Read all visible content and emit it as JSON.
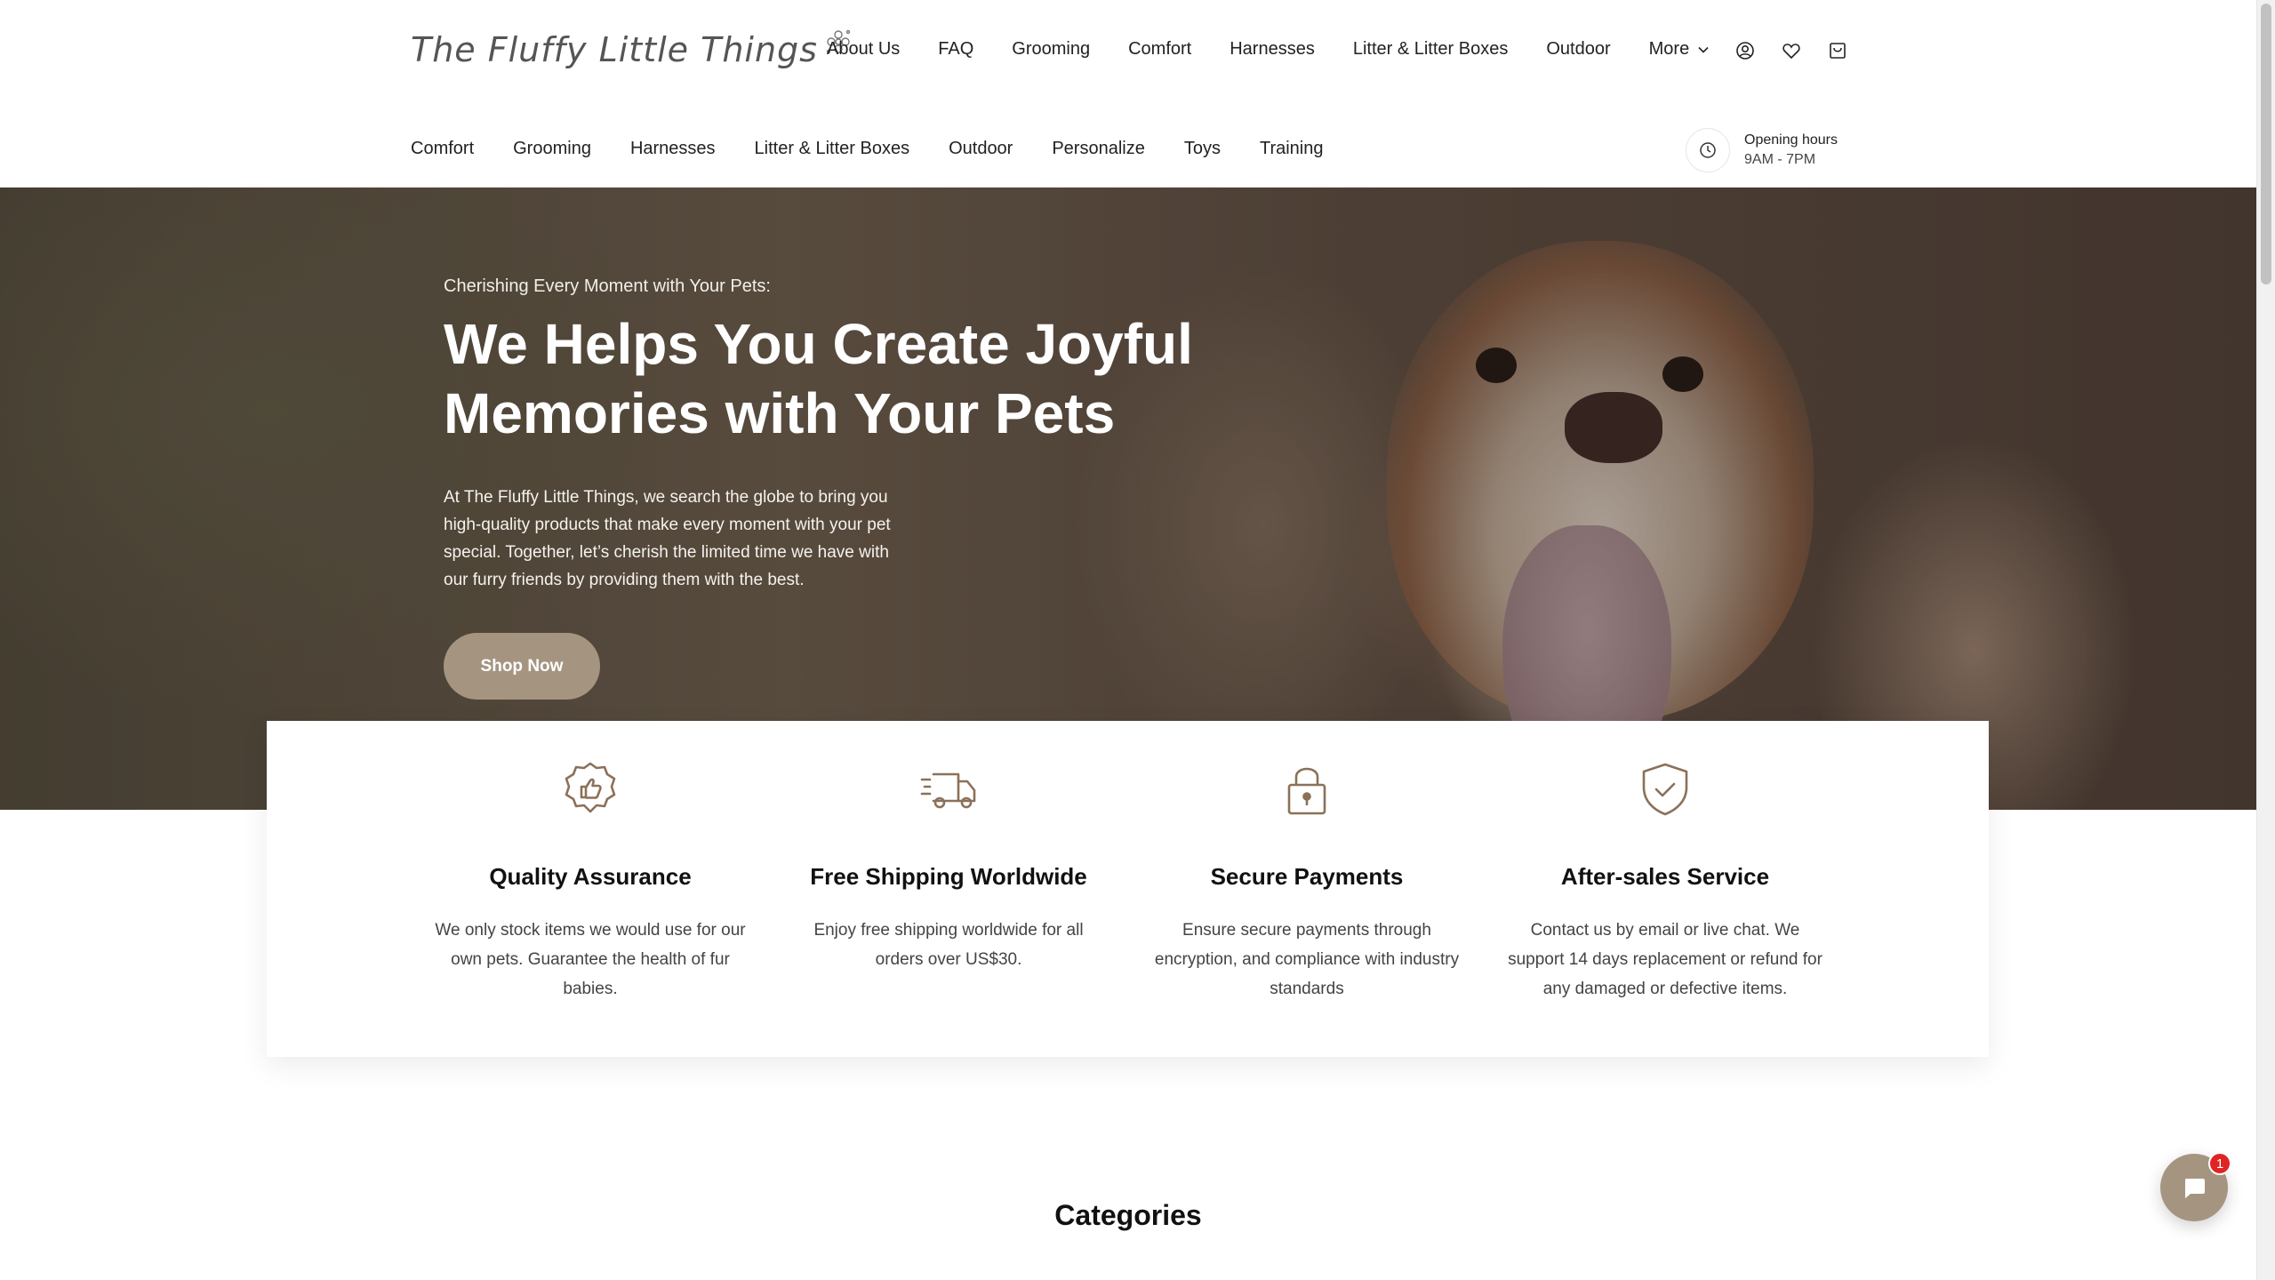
{
  "header": {
    "logo_text": "The Fluffy Little Things",
    "main_nav": [
      "About Us",
      "FAQ",
      "Grooming",
      "Comfort",
      "Harnesses",
      "Litter & Litter Boxes",
      "Outdoor"
    ],
    "more_label": "More",
    "icons": [
      "account-icon",
      "heart-icon",
      "cart-icon"
    ],
    "sub_nav": [
      "Comfort",
      "Grooming",
      "Harnesses",
      "Litter & Litter Boxes",
      "Outdoor",
      "Personalize",
      "Toys",
      "Training"
    ],
    "hours_title": "Opening hours",
    "hours_time": "9AM - 7PM"
  },
  "hero": {
    "kicker": "Cherishing Every Moment with Your Pets:",
    "title_line1": "We Helps You Create Joyful",
    "title_line2": "Memories with Your Pets",
    "body": "At The Fluffy Little Things, we search the globe to bring you high-quality products that make every moment with your pet special. Together, let’s cherish the limited time we have with our furry friends by providing them with the best.",
    "button": "Shop Now"
  },
  "features": [
    {
      "icon": "quality-badge-icon",
      "title": "Quality Assurance",
      "text": "We only stock items we would use for our own pets. Guarantee the health of fur babies."
    },
    {
      "icon": "delivery-truck-icon",
      "title": "Free Shipping Worldwide",
      "text": "Enjoy free shipping worldwide for all orders over US$30."
    },
    {
      "icon": "lock-icon",
      "title": "Secure Payments",
      "text": "Ensure secure payments through encryption, and compliance with industry standards"
    },
    {
      "icon": "shield-check-icon",
      "title": "After-sales Service",
      "text": "Contact us by email or live chat. We support 14 days replacement or refund for any damaged or defective items."
    }
  ],
  "categories_title": "Categories",
  "chat": {
    "badge_count": "1"
  },
  "colors": {
    "accent": "#a59580",
    "icon_brown": "#8b7158"
  }
}
